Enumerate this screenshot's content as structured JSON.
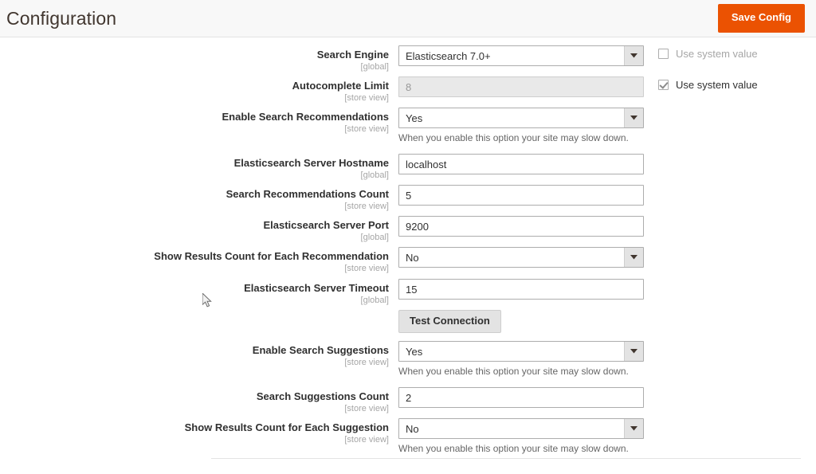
{
  "header": {
    "title": "Configuration",
    "save_label": "Save Config"
  },
  "common": {
    "use_system_value_label": "Use system value",
    "slow_down_note": "When you enable this option your site may slow down.",
    "scope_global": "[global]",
    "scope_store_view": "[store view]",
    "test_connection_label": "Test Connection"
  },
  "fields": [
    {
      "label": "Search Engine",
      "scope": "[global]",
      "type": "select",
      "value": "Elasticsearch 7.0+",
      "use_system": {
        "present": true,
        "checked": false,
        "label": "Use system value"
      }
    },
    {
      "label": "Autocomplete Limit",
      "scope": "[store view]",
      "type": "text",
      "value": "8",
      "disabled": true,
      "use_system": {
        "present": true,
        "checked": true,
        "label": "Use system value"
      }
    },
    {
      "label": "Enable Search Recommendations",
      "scope": "[store view]",
      "type": "select",
      "value": "Yes",
      "note": "When you enable this option your site may slow down."
    },
    {
      "label": "Elasticsearch Server Hostname",
      "scope": "[global]",
      "type": "text",
      "value": "localhost"
    },
    {
      "label": "Search Recommendations Count",
      "scope": "[store view]",
      "type": "text",
      "value": "5"
    },
    {
      "label": "Elasticsearch Server Port",
      "scope": "[global]",
      "type": "text",
      "value": "9200"
    },
    {
      "label": "Show Results Count for Each Recommendation",
      "scope": "[store view]",
      "type": "select",
      "value": "No"
    },
    {
      "label": "Elasticsearch Server Timeout",
      "scope": "[global]",
      "type": "text",
      "value": "15"
    },
    {
      "label": "",
      "scope": "",
      "type": "button",
      "value": "Test Connection"
    },
    {
      "label": "Enable Search Suggestions",
      "scope": "[store view]",
      "type": "select",
      "value": "Yes",
      "note": "When you enable this option your site may slow down."
    },
    {
      "label": "Search Suggestions Count",
      "scope": "[store view]",
      "type": "text",
      "value": "2"
    },
    {
      "label": "Show Results Count for Each Suggestion",
      "scope": "[store view]",
      "type": "select",
      "value": "No",
      "note": "When you enable this option your site may slow down."
    }
  ],
  "colors": {
    "accent_orange": "#eb5202",
    "header_bg": "#f8f8f8",
    "border": "#adadad",
    "scope_text": "#a6a6a6"
  }
}
